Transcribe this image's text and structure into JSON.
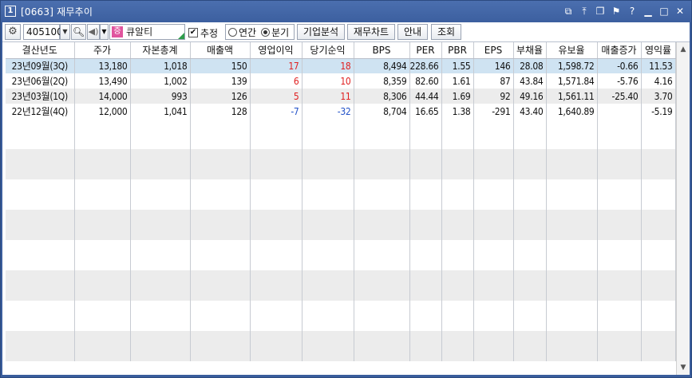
{
  "window": {
    "number": "1",
    "title": "[0663] 재무추이",
    "title_icons": [
      "link-icon",
      "pin-icon",
      "copy-icon",
      "flag-icon",
      "help-icon",
      "minimize-icon",
      "maximize-icon",
      "close-icon"
    ]
  },
  "toolbar": {
    "stock_code": "405100",
    "stock_name": "큐알티",
    "market_badge": "증",
    "estimate_label": "추정",
    "estimate_checked": true,
    "radio_annual": "연간",
    "radio_quarter": "분기",
    "selected_period": "분기",
    "btn_company": "기업분석",
    "btn_chart": "재무차트",
    "btn_guide": "안내",
    "btn_query": "조회"
  },
  "table": {
    "headers": [
      "결산년도",
      "주가",
      "자본총계",
      "매출액",
      "영업이익",
      "당기순익",
      "BPS",
      "PER",
      "PBR",
      "EPS",
      "부채율",
      "유보율",
      "매출증가",
      "영익률"
    ],
    "rows": [
      [
        "23년09월(3Q)",
        "13,180",
        "1,018",
        "150",
        "17",
        "18",
        "8,494",
        "228.66",
        "1.55",
        "146",
        "28.08",
        "1,598.72",
        "-0.66",
        "11.53"
      ],
      [
        "23년06월(2Q)",
        "13,490",
        "1,002",
        "139",
        "6",
        "10",
        "8,359",
        "82.60",
        "1.61",
        "87",
        "43.84",
        "1,571.84",
        "-5.76",
        "4.16"
      ],
      [
        "23년03월(1Q)",
        "14,000",
        "993",
        "126",
        "5",
        "11",
        "8,306",
        "44.44",
        "1.69",
        "92",
        "49.16",
        "1,561.11",
        "-25.40",
        "3.70"
      ],
      [
        "22년12월(4Q)",
        "12,000",
        "1,041",
        "128",
        "-7",
        "-32",
        "8,704",
        "16.65",
        "1.38",
        "-291",
        "43.40",
        "1,640.89",
        "",
        "-5.19"
      ]
    ]
  },
  "colors": {
    "positive": "#e02020",
    "negative": "#2050c8",
    "selected_row": "#cfe3f2",
    "title_bar": "#3c5f9f"
  }
}
